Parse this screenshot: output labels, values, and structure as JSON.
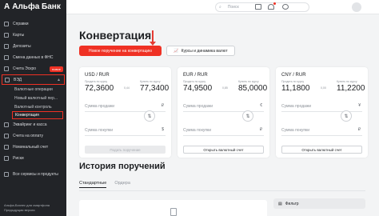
{
  "sidebar": {
    "logo": "Альфа Банк",
    "logo_mark": "A",
    "items": [
      {
        "label": "Справки"
      },
      {
        "label": "Карты"
      },
      {
        "label": "Депозиты"
      },
      {
        "label": "Смена данных в ФНС"
      },
      {
        "label": "Счета Эскро",
        "badge": "новое"
      },
      {
        "label": "ВЭД"
      }
    ],
    "ved_sub": [
      {
        "label": "Валютные операции"
      },
      {
        "label": "Новый валютный пер..."
      },
      {
        "label": "Валютный контроль"
      },
      {
        "label": "Конвертация"
      }
    ],
    "items_after": [
      {
        "label": "Эквайринг и касса"
      },
      {
        "label": "Счета на оплату"
      },
      {
        "label": "Номинальный счет"
      },
      {
        "label": "Риски"
      },
      {
        "label": "Все сервисы и продукты"
      }
    ],
    "bottom_line1": "Альфа-Бизнес для смартфона",
    "bottom_line2": "Предыдущая версия"
  },
  "topbar": {
    "search_placeholder": "Поиск"
  },
  "main": {
    "title": "Конвертация",
    "btn_new": "Новое поручение на конвертацию",
    "btn_rates": "Курсы и динамика валют",
    "cards": [
      {
        "pair": "USD / RUR",
        "buy_label": "Продать по курсу",
        "sell_label": "Купить по курсу",
        "buy_rate": "72,3600",
        "sell_rate": "77,3400",
        "change": "0,44",
        "sell_field": "Сумма продажи",
        "buy_field": "Сумма покупки",
        "sell_cur": "₽",
        "buy_cur": "$",
        "button": "Подать поручение",
        "button_style": "disabled"
      },
      {
        "pair": "EUR / RUR",
        "buy_label": "Продать по курсу",
        "sell_label": "Купить по курсу",
        "buy_rate": "74,9500",
        "sell_rate": "85,0000",
        "change": "0,85",
        "sell_field": "Сумма продажи",
        "buy_field": "Сумма покупки",
        "sell_cur": "€",
        "buy_cur": "₽",
        "button": "Открыть валютный счет",
        "button_style": "outline"
      },
      {
        "pair": "CNY / RUR",
        "buy_label": "Продать по курсу",
        "sell_label": "Купить по курсу",
        "buy_rate": "11,1800",
        "sell_rate": "11,2200",
        "change": "0,00",
        "sell_field": "Сумма продажи",
        "buy_field": "Сумма покупки",
        "sell_cur": "¥",
        "buy_cur": "₽",
        "button": "Открыть валютный счет",
        "button_style": "outline"
      }
    ],
    "history_title": "История поручений",
    "tabs": [
      {
        "label": "Стандартные"
      },
      {
        "label": "Ордера"
      }
    ],
    "filter": "Фильтр"
  }
}
